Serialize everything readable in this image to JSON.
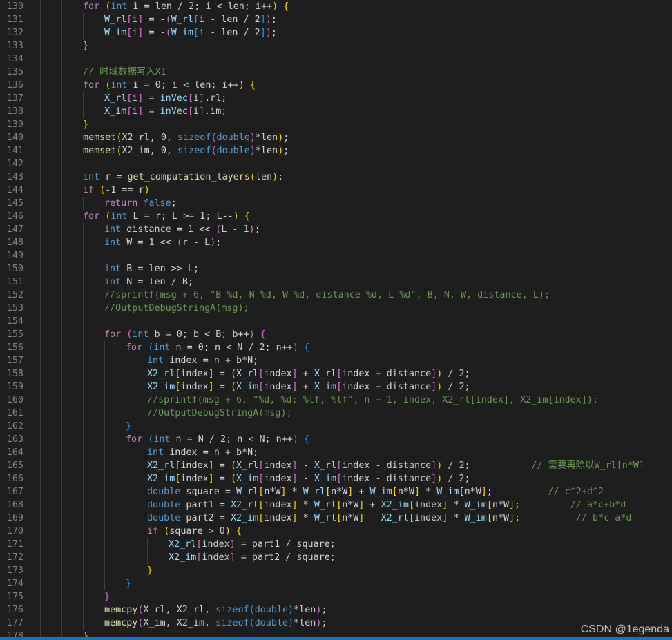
{
  "editor": {
    "colors": {
      "background": "#1e1e1e",
      "keyword": "#569cd6",
      "control": "#c586c0",
      "function": "#dcdcaa",
      "comment": "#6a9955",
      "string": "#ce9178",
      "number": "#b5cea8",
      "bracket1": "#ffd700",
      "bracket2": "#da70d6",
      "bracket3": "#179fff"
    },
    "lines": [
      {
        "n": "130",
        "ind": 2,
        "t": [
          [
            "for",
            "ctl"
          ],
          " ",
          [
            "(",
            "b1"
          ],
          [
            "int",
            "kw"
          ],
          " i = len / 2; i < len; i++",
          [
            ")",
            "b1"
          ],
          " ",
          [
            "{",
            "b1"
          ]
        ]
      },
      {
        "n": "131",
        "ind": 3,
        "t": [
          [
            "W_rl",
            "var"
          ],
          [
            "[",
            "b2"
          ],
          "i",
          [
            "]",
            "b2"
          ],
          " = -",
          [
            "(",
            "b2"
          ],
          [
            "W_rl",
            "var"
          ],
          [
            "[",
            "b3"
          ],
          "i - len / 2",
          [
            "]",
            "b3"
          ],
          [
            ")",
            "b2"
          ],
          ";"
        ]
      },
      {
        "n": "132",
        "ind": 3,
        "t": [
          [
            "W_im",
            "var"
          ],
          [
            "[",
            "b2"
          ],
          "i",
          [
            "]",
            "b2"
          ],
          " = -",
          [
            "(",
            "b2"
          ],
          [
            "W_im",
            "var"
          ],
          [
            "[",
            "b3"
          ],
          "i - len / 2",
          [
            "]",
            "b3"
          ],
          [
            ")",
            "b2"
          ],
          ";"
        ]
      },
      {
        "n": "133",
        "ind": 2,
        "t": [
          [
            "}",
            "b1"
          ]
        ]
      },
      {
        "n": "134",
        "ind": 0,
        "t": []
      },
      {
        "n": "135",
        "ind": 2,
        "t": [
          [
            "// 时域数据写入X1",
            "com"
          ]
        ]
      },
      {
        "n": "136",
        "ind": 2,
        "t": [
          [
            "for",
            "ctl"
          ],
          " ",
          [
            "(",
            "b1"
          ],
          [
            "int",
            "kw"
          ],
          " i = 0; i < len; i++",
          [
            ")",
            "b1"
          ],
          " ",
          [
            "{",
            "b1"
          ]
        ]
      },
      {
        "n": "137",
        "ind": 3,
        "t": [
          [
            "X_rl",
            "var"
          ],
          [
            "[",
            "b2"
          ],
          "i",
          [
            "]",
            "b2"
          ],
          " = ",
          [
            "inVec",
            "var"
          ],
          [
            "[",
            "b2"
          ],
          "i",
          [
            "]",
            "b2"
          ],
          ".rl;"
        ]
      },
      {
        "n": "138",
        "ind": 3,
        "t": [
          [
            "X_im",
            "var"
          ],
          [
            "[",
            "b2"
          ],
          "i",
          [
            "]",
            "b2"
          ],
          " = ",
          [
            "inVec",
            "var"
          ],
          [
            "[",
            "b2"
          ],
          "i",
          [
            "]",
            "b2"
          ],
          ".im;"
        ]
      },
      {
        "n": "139",
        "ind": 2,
        "t": [
          [
            "}",
            "b1"
          ]
        ]
      },
      {
        "n": "140",
        "ind": 2,
        "t": [
          [
            "memset",
            "fn"
          ],
          [
            "(",
            "b1"
          ],
          "X2_rl, 0, ",
          [
            "sizeof",
            "kw"
          ],
          [
            "(",
            "b2"
          ],
          [
            "double",
            "kw"
          ],
          [
            ")",
            "b2"
          ],
          "*len",
          [
            ")",
            "b1"
          ],
          ";"
        ]
      },
      {
        "n": "141",
        "ind": 2,
        "t": [
          [
            "memset",
            "fn"
          ],
          [
            "(",
            "b1"
          ],
          "X2_im, 0, ",
          [
            "sizeof",
            "kw"
          ],
          [
            "(",
            "b2"
          ],
          [
            "double",
            "kw"
          ],
          [
            ")",
            "b2"
          ],
          "*len",
          [
            ")",
            "b1"
          ],
          ";"
        ]
      },
      {
        "n": "142",
        "ind": 0,
        "t": []
      },
      {
        "n": "143",
        "ind": 2,
        "t": [
          [
            "int",
            "kw"
          ],
          " r = ",
          [
            "get_computation_layers",
            "fn"
          ],
          [
            "(",
            "b1"
          ],
          "len",
          [
            ")",
            "b1"
          ],
          ";"
        ]
      },
      {
        "n": "144",
        "ind": 2,
        "t": [
          [
            "if",
            "ctl"
          ],
          " ",
          [
            "(",
            "b1"
          ],
          "-1 == r",
          [
            ")",
            "b1"
          ]
        ]
      },
      {
        "n": "145",
        "ind": 3,
        "t": [
          [
            "return",
            "ctl"
          ],
          " ",
          [
            "false",
            "kw"
          ],
          ";"
        ]
      },
      {
        "n": "146",
        "ind": 2,
        "t": [
          [
            "for",
            "ctl"
          ],
          " ",
          [
            "(",
            "b1"
          ],
          [
            "int",
            "kw"
          ],
          " L = r; L >= 1; L--",
          [
            ")",
            "b1"
          ],
          " ",
          [
            "{",
            "b1"
          ]
        ]
      },
      {
        "n": "147",
        "ind": 3,
        "t": [
          [
            "int",
            "kw"
          ],
          " distance = 1 << ",
          [
            "(",
            "b2"
          ],
          "L - 1",
          [
            ")",
            "b2"
          ],
          ";"
        ]
      },
      {
        "n": "148",
        "ind": 3,
        "t": [
          [
            "int",
            "kw"
          ],
          " W = 1 << ",
          [
            "(",
            "b2"
          ],
          "r - L",
          [
            ")",
            "b2"
          ],
          ";"
        ]
      },
      {
        "n": "149",
        "ind": 0,
        "t": []
      },
      {
        "n": "150",
        "ind": 3,
        "t": [
          [
            "int",
            "kw"
          ],
          " B = len >> L;"
        ]
      },
      {
        "n": "151",
        "ind": 3,
        "t": [
          [
            "int",
            "kw"
          ],
          " N = len / B;"
        ]
      },
      {
        "n": "152",
        "ind": 3,
        "t": [
          [
            "//sprintf(msg + 6, \"B %d, N %d, W %d, distance %d, L %d\", B, N, W, distance, L);",
            "com"
          ]
        ]
      },
      {
        "n": "153",
        "ind": 3,
        "t": [
          [
            "//OutputDebugStringA(msg);",
            "com"
          ]
        ]
      },
      {
        "n": "154",
        "ind": 0,
        "t": []
      },
      {
        "n": "155",
        "ind": 3,
        "t": [
          [
            "for",
            "ctl"
          ],
          " ",
          [
            "(",
            "b2"
          ],
          [
            "int",
            "kw"
          ],
          " b = 0; b < B; b++",
          [
            ")",
            "b2"
          ],
          " ",
          [
            "{",
            "b2"
          ]
        ]
      },
      {
        "n": "156",
        "ind": 4,
        "t": [
          [
            "for",
            "ctl"
          ],
          " ",
          [
            "(",
            "b3"
          ],
          [
            "int",
            "kw"
          ],
          " n = 0; n < N / 2; n++",
          [
            ")",
            "b3"
          ],
          " ",
          [
            "{",
            "b3"
          ]
        ]
      },
      {
        "n": "157",
        "ind": 5,
        "t": [
          [
            "int",
            "kw"
          ],
          " index = n + b*N;"
        ]
      },
      {
        "n": "158",
        "ind": 5,
        "t": [
          [
            "X2_rl",
            "var"
          ],
          [
            "[",
            "b1"
          ],
          "index",
          [
            "]",
            "b1"
          ],
          " = ",
          [
            "(",
            "b1"
          ],
          [
            "X_rl",
            "var"
          ],
          [
            "[",
            "b2"
          ],
          "index",
          [
            "]",
            "b2"
          ],
          " + ",
          [
            "X_rl",
            "var"
          ],
          [
            "[",
            "b2"
          ],
          "index + distance",
          [
            "]",
            "b2"
          ],
          [
            ")",
            "b1"
          ],
          " / 2;"
        ]
      },
      {
        "n": "159",
        "ind": 5,
        "t": [
          [
            "X2_im",
            "var"
          ],
          [
            "[",
            "b1"
          ],
          "index",
          [
            "]",
            "b1"
          ],
          " = ",
          [
            "(",
            "b1"
          ],
          [
            "X_im",
            "var"
          ],
          [
            "[",
            "b2"
          ],
          "index",
          [
            "]",
            "b2"
          ],
          " + ",
          [
            "X_im",
            "var"
          ],
          [
            "[",
            "b2"
          ],
          "index + distance",
          [
            "]",
            "b2"
          ],
          [
            ")",
            "b1"
          ],
          " / 2;"
        ]
      },
      {
        "n": "160",
        "ind": 5,
        "t": [
          [
            "//sprintf(msg + 6, \"%d, %d: %lf, %lf\", n + 1, index, X2_rl[index], X2_im[index]);",
            "com"
          ]
        ]
      },
      {
        "n": "161",
        "ind": 5,
        "t": [
          [
            "//OutputDebugStringA(msg);",
            "com"
          ]
        ]
      },
      {
        "n": "162",
        "ind": 4,
        "t": [
          [
            "}",
            "b3"
          ]
        ]
      },
      {
        "n": "163",
        "ind": 4,
        "t": [
          [
            "for",
            "ctl"
          ],
          " ",
          [
            "(",
            "b3"
          ],
          [
            "int",
            "kw"
          ],
          " n = N / 2; n < N; n++",
          [
            ")",
            "b3"
          ],
          " ",
          [
            "{",
            "b3"
          ]
        ]
      },
      {
        "n": "164",
        "ind": 5,
        "t": [
          [
            "int",
            "kw"
          ],
          " index = n + b*N;"
        ]
      },
      {
        "n": "165",
        "ind": 5,
        "t": [
          [
            "X2_rl",
            "var"
          ],
          [
            "[",
            "b1"
          ],
          "index",
          [
            "]",
            "b1"
          ],
          " = ",
          [
            "(",
            "b1"
          ],
          [
            "X_rl",
            "var"
          ],
          [
            "[",
            "b2"
          ],
          "index",
          [
            "]",
            "b2"
          ],
          " - ",
          [
            "X_rl",
            "var"
          ],
          [
            "[",
            "b2"
          ],
          "index - distance",
          [
            "]",
            "b2"
          ],
          [
            ")",
            "b1"
          ],
          " / 2;           ",
          [
            "// 需要再除以W_rl[n*W]",
            "com"
          ]
        ]
      },
      {
        "n": "166",
        "ind": 5,
        "t": [
          [
            "X2_im",
            "var"
          ],
          [
            "[",
            "b1"
          ],
          "index",
          [
            "]",
            "b1"
          ],
          " = ",
          [
            "(",
            "b1"
          ],
          [
            "X_im",
            "var"
          ],
          [
            "[",
            "b2"
          ],
          "index",
          [
            "]",
            "b2"
          ],
          " - ",
          [
            "X_im",
            "var"
          ],
          [
            "[",
            "b2"
          ],
          "index - distance",
          [
            "]",
            "b2"
          ],
          [
            ")",
            "b1"
          ],
          " / 2;"
        ]
      },
      {
        "n": "167",
        "ind": 5,
        "t": [
          [
            "double",
            "kw"
          ],
          " square = ",
          [
            "W_rl",
            "var"
          ],
          [
            "[",
            "b1"
          ],
          "n*W",
          [
            "]",
            "b1"
          ],
          " * ",
          [
            "W_rl",
            "var"
          ],
          [
            "[",
            "b1"
          ],
          "n*W",
          [
            "]",
            "b1"
          ],
          " + ",
          [
            "W_im",
            "var"
          ],
          [
            "[",
            "b1"
          ],
          "n*W",
          [
            "]",
            "b1"
          ],
          " * ",
          [
            "W_im",
            "var"
          ],
          [
            "[",
            "b1"
          ],
          "n*W",
          [
            "]",
            "b1"
          ],
          ";          ",
          [
            "// c^2+d^2",
            "com"
          ]
        ]
      },
      {
        "n": "168",
        "ind": 5,
        "t": [
          [
            "double",
            "kw"
          ],
          " part1 = ",
          [
            "X2_rl",
            "var"
          ],
          [
            "[",
            "b1"
          ],
          "index",
          [
            "]",
            "b1"
          ],
          " * ",
          [
            "W_rl",
            "var"
          ],
          [
            "[",
            "b1"
          ],
          "n*W",
          [
            "]",
            "b1"
          ],
          " + ",
          [
            "X2_im",
            "var"
          ],
          [
            "[",
            "b1"
          ],
          "index",
          [
            "]",
            "b1"
          ],
          " * ",
          [
            "W_im",
            "var"
          ],
          [
            "[",
            "b1"
          ],
          "n*W",
          [
            "]",
            "b1"
          ],
          ";         ",
          [
            "// a*c+b*d",
            "com"
          ]
        ]
      },
      {
        "n": "169",
        "ind": 5,
        "t": [
          [
            "double",
            "kw"
          ],
          " part2 = ",
          [
            "X2_im",
            "var"
          ],
          [
            "[",
            "b1"
          ],
          "index",
          [
            "]",
            "b1"
          ],
          " * ",
          [
            "W_rl",
            "var"
          ],
          [
            "[",
            "b1"
          ],
          "n*W",
          [
            "]",
            "b1"
          ],
          " - ",
          [
            "X2_rl",
            "var"
          ],
          [
            "[",
            "b1"
          ],
          "index",
          [
            "]",
            "b1"
          ],
          " * ",
          [
            "W_im",
            "var"
          ],
          [
            "[",
            "b1"
          ],
          "n*W",
          [
            "]",
            "b1"
          ],
          ";          ",
          [
            "// b*c-a*d",
            "com"
          ]
        ]
      },
      {
        "n": "170",
        "ind": 5,
        "t": [
          [
            "if",
            "ctl"
          ],
          " ",
          [
            "(",
            "b1"
          ],
          "square > 0",
          [
            ")",
            "b1"
          ],
          " ",
          [
            "{",
            "b1"
          ]
        ]
      },
      {
        "n": "171",
        "ind": 6,
        "t": [
          [
            "X2_rl",
            "var"
          ],
          [
            "[",
            "b2"
          ],
          "index",
          [
            "]",
            "b2"
          ],
          " = part1 / square;"
        ]
      },
      {
        "n": "172",
        "ind": 6,
        "t": [
          [
            "X2_im",
            "var"
          ],
          [
            "[",
            "b2"
          ],
          "index",
          [
            "]",
            "b2"
          ],
          " = part2 / square;"
        ]
      },
      {
        "n": "173",
        "ind": 5,
        "t": [
          [
            "}",
            "b1"
          ]
        ]
      },
      {
        "n": "174",
        "ind": 4,
        "t": [
          [
            "}",
            "b3"
          ]
        ]
      },
      {
        "n": "175",
        "ind": 3,
        "t": [
          [
            "}",
            "b2"
          ]
        ]
      },
      {
        "n": "176",
        "ind": 3,
        "t": [
          [
            "memcpy",
            "fn"
          ],
          [
            "(",
            "b2"
          ],
          "X_rl, X2_rl, ",
          [
            "sizeof",
            "kw"
          ],
          [
            "(",
            "b3"
          ],
          [
            "double",
            "kw"
          ],
          [
            ")",
            "b3"
          ],
          "*len",
          [
            ")",
            "b2"
          ],
          ";"
        ]
      },
      {
        "n": "177",
        "ind": 3,
        "t": [
          [
            "memcpy",
            "fn"
          ],
          [
            "(",
            "b2"
          ],
          "X_im, X2_im, ",
          [
            "sizeof",
            "kw"
          ],
          [
            "(",
            "b3"
          ],
          [
            "double",
            "kw"
          ],
          [
            ")",
            "b3"
          ],
          "*len",
          [
            ")",
            "b2"
          ],
          ";"
        ]
      },
      {
        "n": "178",
        "ind": 2,
        "t": [
          [
            "}",
            "b1"
          ]
        ]
      }
    ]
  },
  "watermark": "CSDN @1egenda"
}
